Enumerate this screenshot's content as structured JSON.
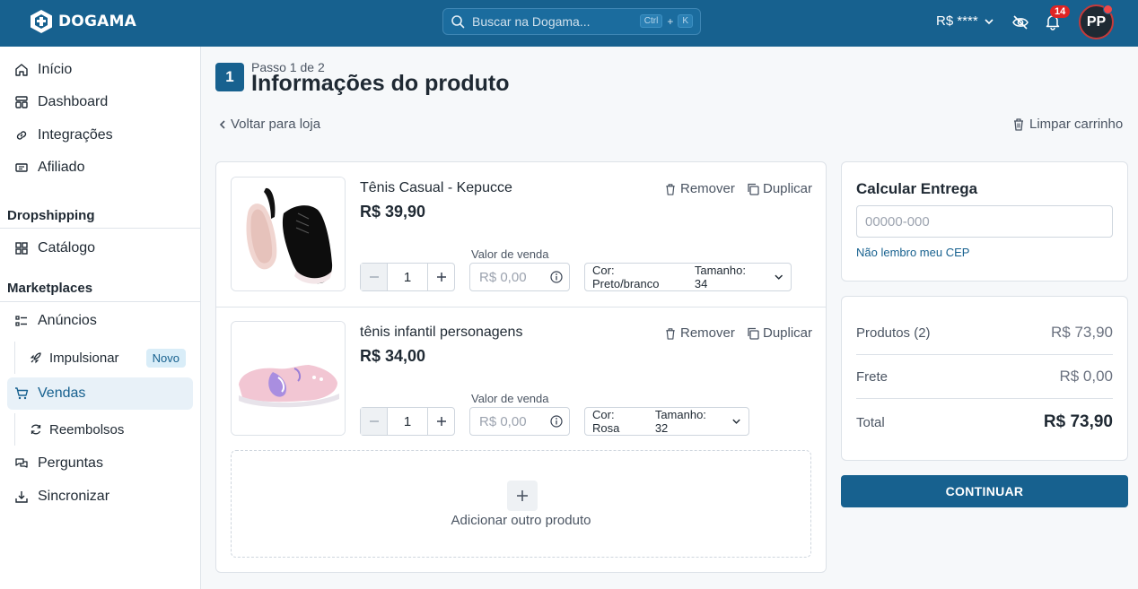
{
  "colors": {
    "brand": "#17618f",
    "danger": "#e02424"
  },
  "header": {
    "logo_text": "DOGAMA",
    "search_placeholder": "Buscar na Dogama...",
    "shortcut_key1": "Ctrl",
    "shortcut_plus": "+",
    "shortcut_key2": "K",
    "balance": "R$ ****",
    "notifications_count": "14",
    "avatar_initials": "PP"
  },
  "sidebar": {
    "items": [
      {
        "label": "Início",
        "icon": "home-icon"
      },
      {
        "label": "Dashboard",
        "icon": "dashboard-icon"
      },
      {
        "label": "Integrações",
        "icon": "link-icon"
      },
      {
        "label": "Afiliado",
        "icon": "ticket-icon"
      }
    ],
    "section_dropshipping": "Dropshipping",
    "catalogo": "Catálogo",
    "section_marketplaces": "Marketplaces",
    "anuncios": "Anúncios",
    "impulsionar": "Impulsionar",
    "novo_badge": "Novo",
    "vendas": "Vendas",
    "reembolsos": "Reembolsos",
    "perguntas": "Perguntas",
    "sincronizar": "Sincronizar"
  },
  "main": {
    "step_number": "1",
    "step_label": "Passo 1 de 2",
    "title": "Informações do produto",
    "back_link": "Voltar para loja",
    "clear_cart": "Limpar carrinho",
    "remove_label": "Remover",
    "duplicate_label": "Duplicar",
    "sale_value_label": "Valor de venda",
    "price_placeholder": "R$ 0,00",
    "products": [
      {
        "name": "Tênis Casual - Kepucce",
        "price": "R$ 39,90",
        "quantity": "1",
        "color": "Cor: Preto/branco",
        "size": "Tamanho: 34"
      },
      {
        "name": "tênis infantil personagens",
        "price": "R$ 34,00",
        "quantity": "1",
        "color": "Cor: Rosa",
        "size": "Tamanho: 32"
      }
    ],
    "add_product": "Adicionar outro produto"
  },
  "shipping": {
    "title": "Calcular Entrega",
    "cep_placeholder": "00000-000",
    "cep_help": "Não lembro meu CEP"
  },
  "summary": {
    "products_label": "Produtos (2)",
    "products_value": "R$ 73,90",
    "shipping_label": "Frete",
    "shipping_value": "R$ 0,00",
    "total_label": "Total",
    "total_value": "R$ 73,90"
  },
  "continue_button": "CONTINUAR"
}
